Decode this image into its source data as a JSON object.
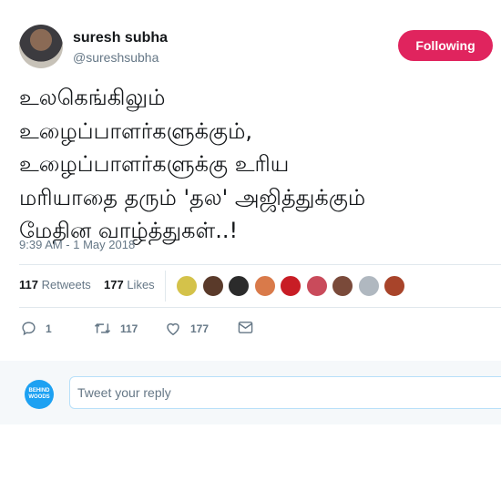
{
  "author": {
    "name": "suresh subha",
    "handle": "@sureshsubha"
  },
  "follow_button": {
    "label": "Following",
    "color": "#e0245e"
  },
  "tweet": {
    "text": "உலகெங்கிலும்\nஉழைப்பாளர்களுக்கும்,\nஉழைப்பாளர்களுக்கு உரிய\nமரியாதை தரும் 'தல' அஜித்துக்கும்\nமேதின வாழ்த்துகள்..!",
    "timestamp": "9:39 AM - 1 May 2018"
  },
  "stats": {
    "retweets": "117",
    "retweets_label": "Retweets",
    "likes": "177",
    "likes_label": "Likes"
  },
  "likers": [
    "#d4c24a",
    "#5a3a2a",
    "#2b2b2b",
    "#d97a4a",
    "#c81d25",
    "#c94b5b",
    "#7a4a3a",
    "#b0b8c0",
    "#a8442a"
  ],
  "actions": {
    "replies": "1",
    "retweets": "117",
    "likes": "177"
  },
  "reply": {
    "logo_text": "BEHIND WOODS",
    "placeholder": "Tweet your reply"
  },
  "colors": {
    "accent": "#1da1f2",
    "secondary_text": "#657786",
    "divider": "#e1e8ed"
  }
}
